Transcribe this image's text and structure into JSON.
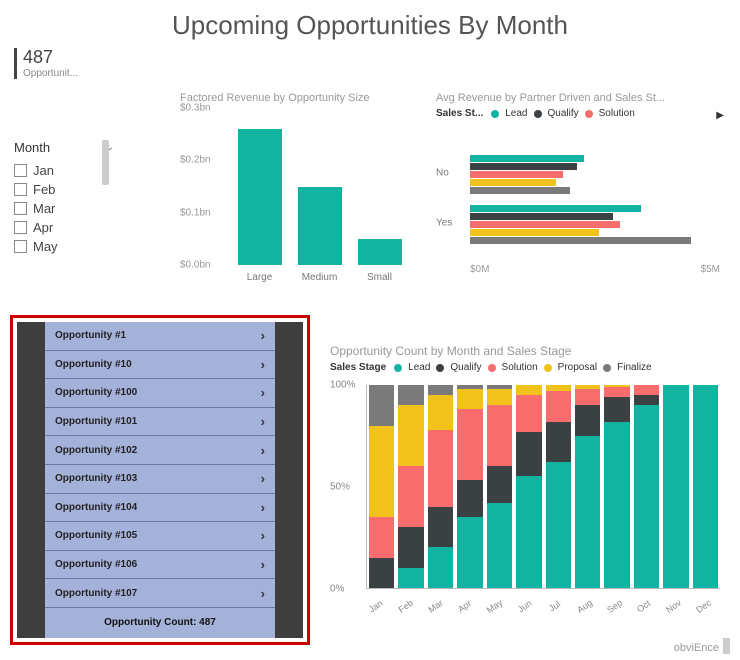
{
  "title": "Upcoming Opportunities By Month",
  "kpi": {
    "value": "487",
    "label": "Opportunit..."
  },
  "slicer": {
    "label": "Month",
    "items": [
      "Jan",
      "Feb",
      "Mar",
      "Apr",
      "May"
    ]
  },
  "opportunity_list": {
    "items": [
      "Opportunity #1",
      "Opportunity #10",
      "Opportunity #100",
      "Opportunity #101",
      "Opportunity #102",
      "Opportunity #103",
      "Opportunity #104",
      "Opportunity #105",
      "Opportunity #106",
      "Opportunity #107"
    ],
    "footer": "Opportunity Count: 487"
  },
  "brand": "obviEnce",
  "legends": {
    "c2_label": "Sales St...",
    "c3_label": "Sales Stage",
    "lead": "Lead",
    "qualify": "Qualify",
    "solution": "Solution",
    "proposal": "Proposal",
    "finalize": "Finalize"
  },
  "chart_data": [
    {
      "id": "c1",
      "type": "bar",
      "title": "Factored Revenue by Opportunity Size",
      "categories": [
        "Large",
        "Medium",
        "Small"
      ],
      "values": [
        0.26,
        0.15,
        0.05
      ],
      "ylabel": "",
      "yticks": [
        "$0.0bn",
        "$0.1bn",
        "$0.2bn",
        "$0.3bn"
      ],
      "ylim": [
        0,
        0.3
      ]
    },
    {
      "id": "c2",
      "type": "bar",
      "orientation": "horizontal",
      "title": "Avg Revenue by Partner Driven and Sales St...",
      "categories": [
        "No",
        "Yes"
      ],
      "series": [
        {
          "name": "Lead",
          "color": "teal",
          "values": [
            3.2,
            4.8
          ]
        },
        {
          "name": "Qualify",
          "color": "dark",
          "values": [
            3.0,
            4.0
          ]
        },
        {
          "name": "Solution",
          "color": "coral",
          "values": [
            2.6,
            4.2
          ]
        },
        {
          "name": "Proposal",
          "color": "gold",
          "values": [
            2.4,
            3.6
          ]
        },
        {
          "name": "Finalize",
          "color": "mid",
          "values": [
            2.8,
            6.2
          ]
        }
      ],
      "xticks": [
        "$0M",
        "$5M"
      ],
      "xlim": [
        0,
        7
      ]
    },
    {
      "id": "c3",
      "type": "bar",
      "stacked": true,
      "normalized": true,
      "title": "Opportunity Count by Month and Sales Stage",
      "categories": [
        "Jan",
        "Feb",
        "Mar",
        "Apr",
        "May",
        "Jun",
        "Jul",
        "Aug",
        "Sep",
        "Oct",
        "Nov",
        "Dec"
      ],
      "series": [
        {
          "name": "Lead",
          "color": "teal",
          "values": [
            0,
            10,
            20,
            35,
            42,
            55,
            62,
            75,
            82,
            90,
            100,
            100
          ]
        },
        {
          "name": "Qualify",
          "color": "dark",
          "values": [
            15,
            20,
            20,
            18,
            18,
            22,
            20,
            15,
            12,
            5,
            0,
            0
          ]
        },
        {
          "name": "Solution",
          "color": "coral",
          "values": [
            20,
            30,
            38,
            35,
            30,
            18,
            15,
            8,
            5,
            5,
            0,
            0
          ]
        },
        {
          "name": "Proposal",
          "color": "gold",
          "values": [
            45,
            30,
            17,
            10,
            8,
            5,
            3,
            2,
            1,
            0,
            0,
            0
          ]
        },
        {
          "name": "Finalize",
          "color": "mid",
          "values": [
            20,
            10,
            5,
            2,
            2,
            0,
            0,
            0,
            0,
            0,
            0,
            0
          ]
        }
      ],
      "yticks": [
        "0%",
        "50%",
        "100%"
      ]
    }
  ]
}
